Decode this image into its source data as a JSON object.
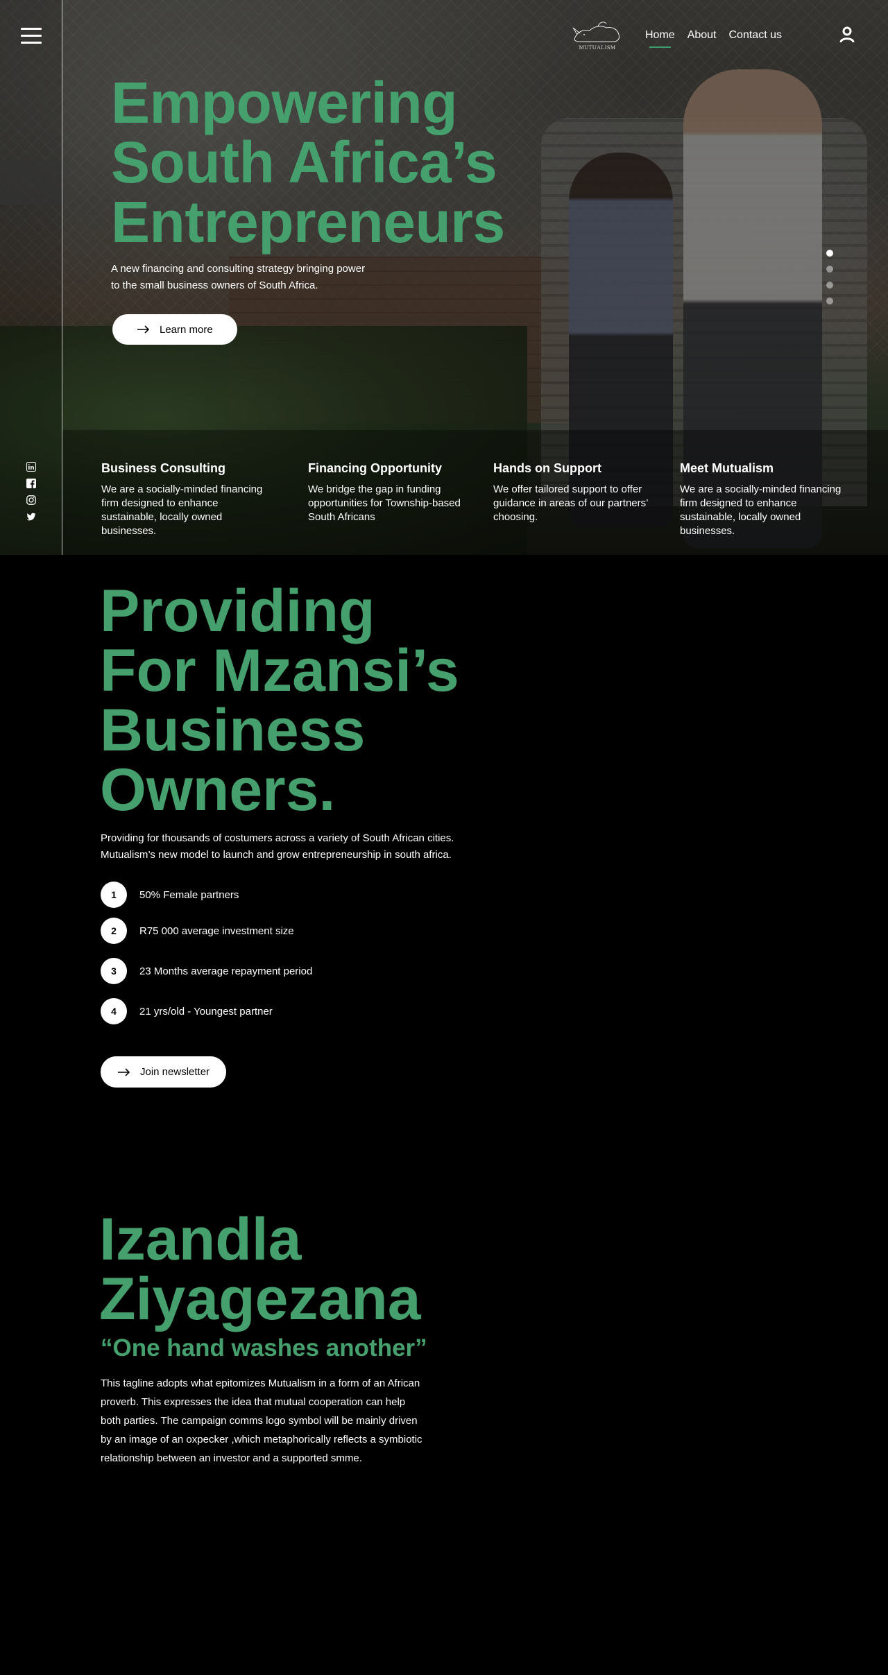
{
  "header": {
    "logo_text": "MUTUALISM",
    "nav": [
      {
        "label": "Home",
        "active": true
      },
      {
        "label": "About",
        "active": false
      },
      {
        "label": "Contact us",
        "active": false
      }
    ]
  },
  "hero": {
    "title_lines": [
      "Empowering",
      "South Africa’s",
      "Entrepreneurs"
    ],
    "subtitle": "A new financing and consulting strategy bringing power to the small business owners of South Africa.",
    "cta_label": "Learn more",
    "slides_total": 4,
    "slide_active": 1
  },
  "features": [
    {
      "title": "Business Consulting",
      "text": "We are a socially-minded financing firm designed to enhance sustainable, locally owned businesses."
    },
    {
      "title": "Financing Opportunity",
      "text": "We bridge the gap in funding opportunities for Township-based South Africans"
    },
    {
      "title": "Hands on Support",
      "text": "We offer tailored support to offer guidance in areas of our partners’ choosing."
    },
    {
      "title": "Meet Mutualism",
      "text": "We are a socially-minded financing firm designed to enhance sustainable, locally owned businesses."
    }
  ],
  "social": [
    "linkedin-icon",
    "facebook-icon",
    "instagram-icon",
    "twitter-icon"
  ],
  "providing": {
    "title_lines": [
      "Providing",
      "For Mzansi’s",
      "Business",
      "Owners."
    ],
    "subtitle": "Providing for thousands of costumers across a variety of South African cities. Mutualism’s new model to launch and grow entrepreneurship in south africa.",
    "stats": [
      {
        "num": "1",
        "label": "50% Female partners"
      },
      {
        "num": "2",
        "label": "R75 000 average investment size"
      },
      {
        "num": "3",
        "label": "23 Months average repayment period"
      },
      {
        "num": "4",
        "label": "21 yrs/old - Youngest partner"
      }
    ],
    "cta_label": "Join newsletter"
  },
  "izandla": {
    "title_lines": [
      "Izandla",
      "Ziyagezana"
    ],
    "quote": "“One hand washes another”",
    "body": "This tagline adopts what epitomizes Mutualism in a form of an African proverb. This expresses the idea that mutual cooperation can help both parties. The campaign comms logo symbol will be mainly driven by an image of an oxpecker ,which metaphorically reflects a symbiotic relationship between an investor and a supported smme."
  },
  "colors": {
    "accent": "#45a06d",
    "background": "#000000",
    "text": "#ffffff"
  }
}
